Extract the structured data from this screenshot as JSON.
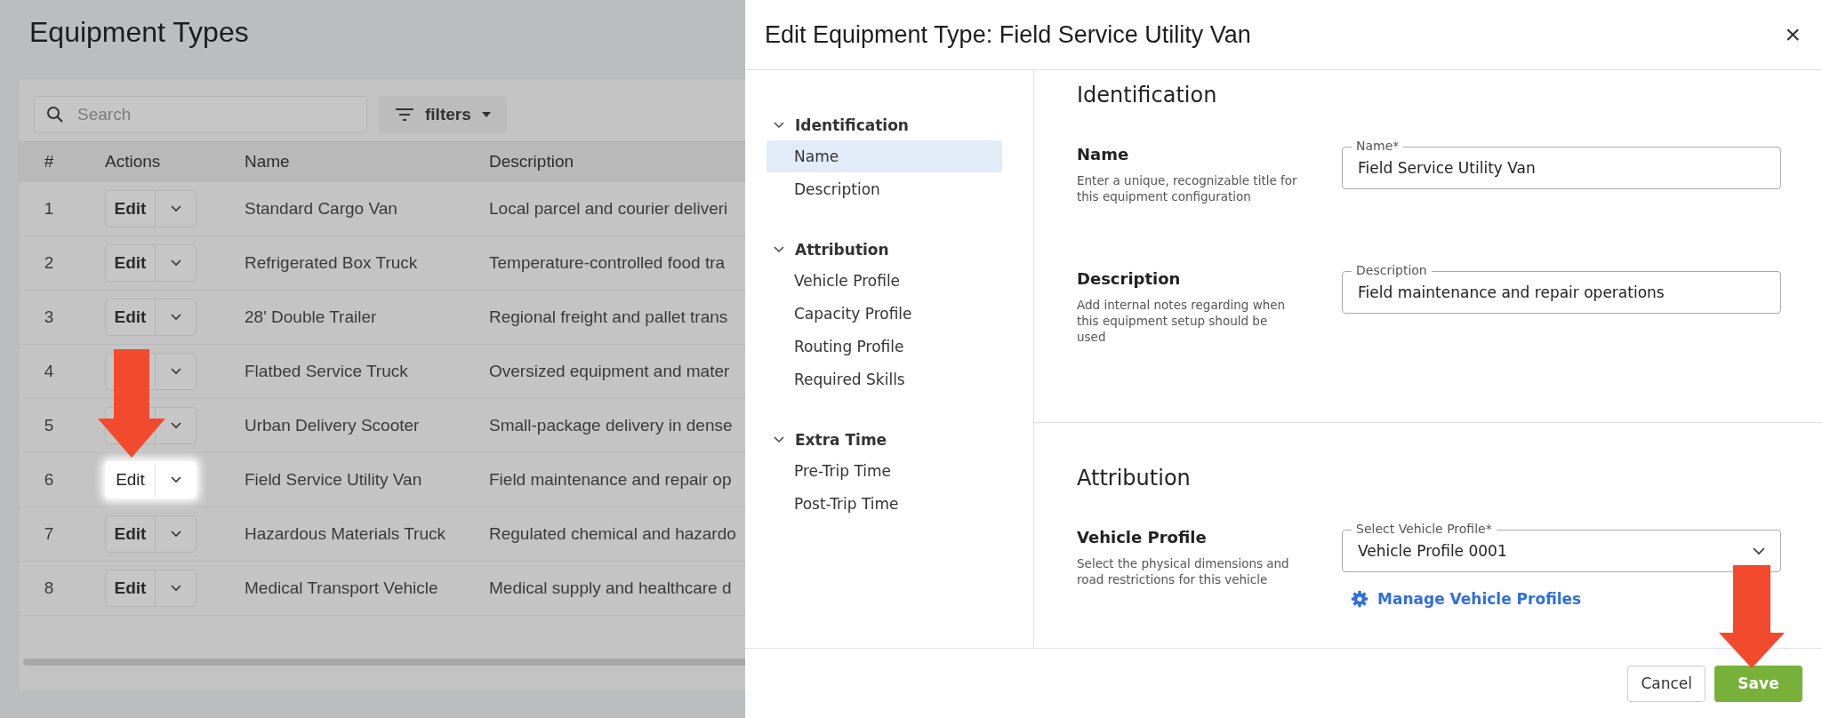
{
  "page": {
    "title": "Equipment Types"
  },
  "toolbar": {
    "search": {
      "placeholder": "Search"
    },
    "filters_label": "filters"
  },
  "table": {
    "columns": [
      "#",
      "Actions",
      "Name",
      "Description"
    ],
    "rows": [
      {
        "index": "1",
        "edit_label": "Edit",
        "highlighted": false,
        "name": "Standard Cargo Van",
        "description": "Local parcel and courier deliveri"
      },
      {
        "index": "2",
        "edit_label": "Edit",
        "highlighted": false,
        "name": "Refrigerated Box Truck",
        "description": "Temperature-controlled food tra"
      },
      {
        "index": "3",
        "edit_label": "Edit",
        "highlighted": false,
        "name": "28' Double Trailer",
        "description": "Regional freight and pallet trans"
      },
      {
        "index": "4",
        "highlighted": false,
        "name": "Flatbed Service Truck",
        "description": "Oversized equipment and mater"
      },
      {
        "index": "5",
        "highlighted": false,
        "name": "Urban Delivery Scooter",
        "description": "Small-package delivery in dense"
      },
      {
        "index": "6",
        "edit_label": "Edit",
        "highlighted": true,
        "name": "Field Service Utility Van",
        "description": "Field maintenance and repair op"
      },
      {
        "index": "7",
        "edit_label": "Edit",
        "highlighted": false,
        "name": "Hazardous Materials Truck",
        "description": "Regulated chemical and hazardo"
      },
      {
        "index": "8",
        "edit_label": "Edit",
        "highlighted": false,
        "name": "Medical Transport Vehicle",
        "description": "Medical supply and healthcare d"
      }
    ]
  },
  "panel": {
    "title": "Edit Equipment Type: Field Service Utility Van",
    "close": "×",
    "nav": [
      {
        "label": "Identification",
        "expanded": true,
        "children": [
          {
            "label": "Name",
            "selected": true
          },
          {
            "label": "Description",
            "selected": false
          }
        ]
      },
      {
        "label": "Attribution",
        "expanded": true,
        "children": [
          {
            "label": "Vehicle Profile",
            "selected": false
          },
          {
            "label": "Capacity Profile",
            "selected": false
          },
          {
            "label": "Routing Profile",
            "selected": false
          },
          {
            "label": "Required Skills",
            "selected": false
          }
        ]
      },
      {
        "label": "Extra Time",
        "expanded": true,
        "children": [
          {
            "label": "Pre-Trip Time",
            "selected": false
          },
          {
            "label": "Post-Trip Time",
            "selected": false
          }
        ]
      }
    ],
    "sections": [
      {
        "title": "Identification",
        "fields": [
          {
            "kind": "text",
            "label": "Name",
            "help": "Enter a unique, recognizable title for this equipment configuration",
            "field_label": "Name*",
            "value": "Field Service Utility Van"
          },
          {
            "kind": "text",
            "label": "Description",
            "help": "Add internal notes regarding when this equipment setup should be used",
            "field_label": "Description",
            "value": "Field maintenance and repair operations"
          }
        ]
      },
      {
        "title": "Attribution",
        "fields": [
          {
            "kind": "select",
            "label": "Vehicle Profile",
            "help": "Select the physical dimensions and road restrictions for this vehicle",
            "field_label": "Select Vehicle Profile*",
            "value": "Vehicle Profile 0001",
            "link": "Manage Vehicle Profiles"
          }
        ]
      }
    ],
    "buttons": {
      "cancel": "Cancel",
      "save": "Save"
    }
  }
}
